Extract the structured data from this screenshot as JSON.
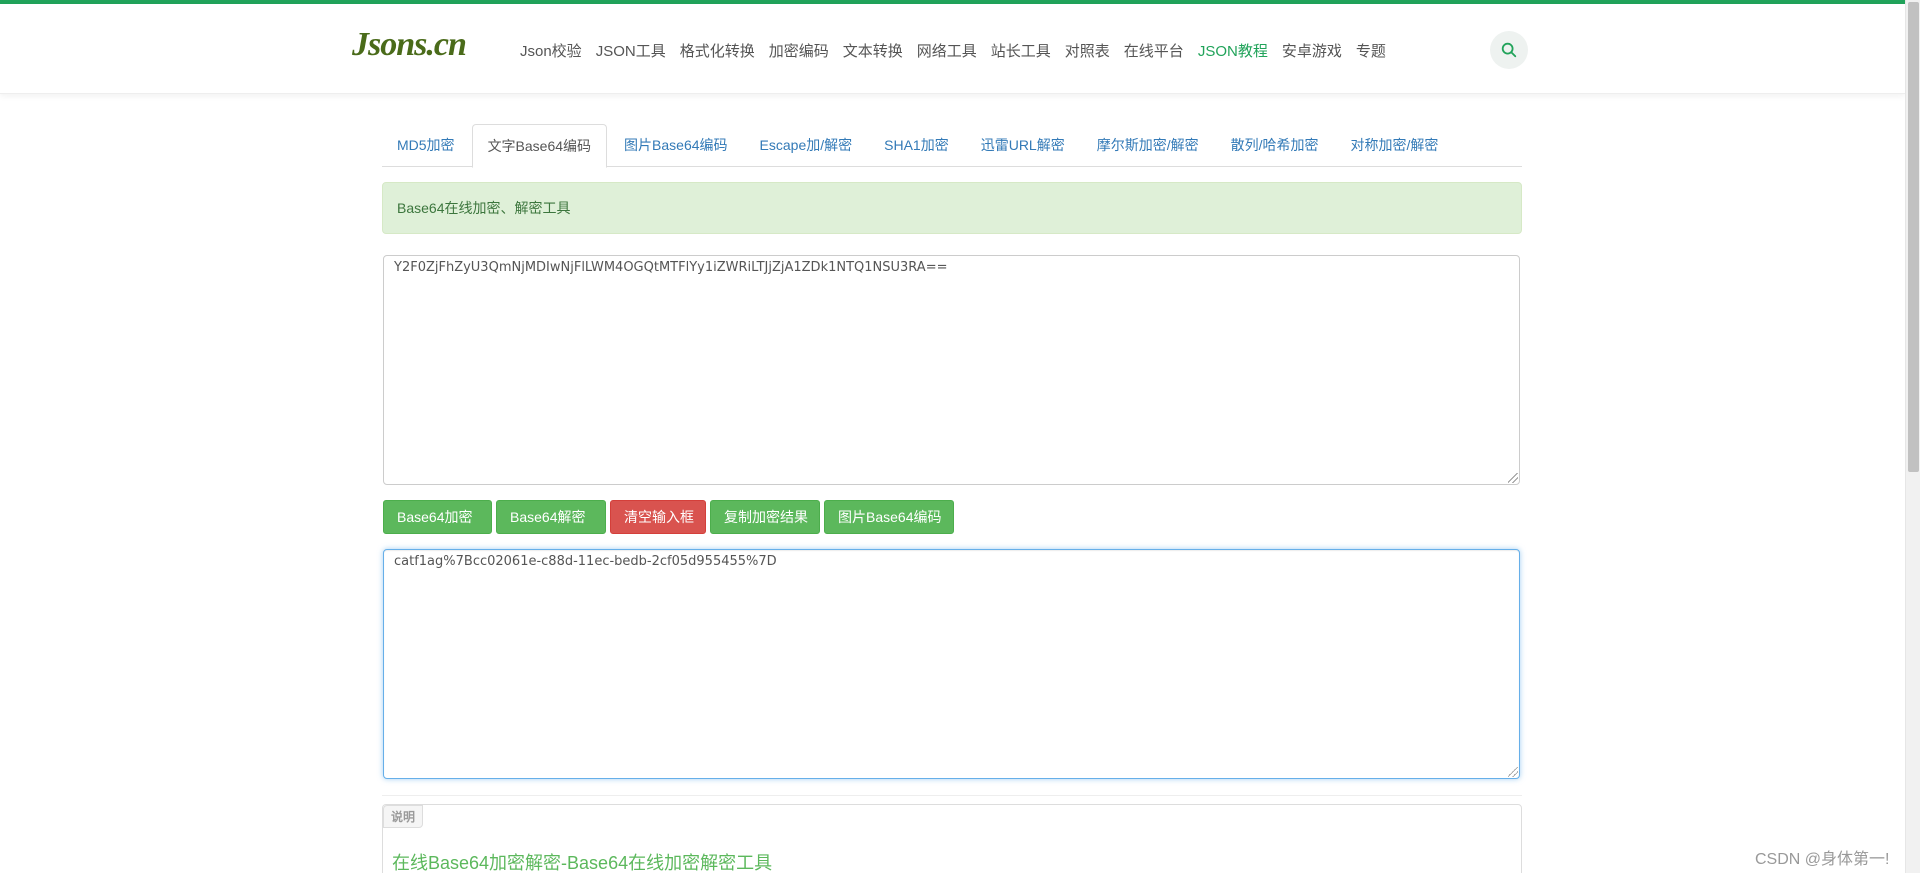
{
  "header": {
    "logo": "Jsons.cn",
    "nav": [
      {
        "label": "Json校验"
      },
      {
        "label": "JSON工具"
      },
      {
        "label": "格式化转换"
      },
      {
        "label": "加密编码"
      },
      {
        "label": "文本转换"
      },
      {
        "label": "网络工具"
      },
      {
        "label": "站长工具"
      },
      {
        "label": "对照表"
      },
      {
        "label": "在线平台"
      },
      {
        "label": "JSON教程"
      },
      {
        "label": "安卓游戏"
      },
      {
        "label": "专题"
      }
    ],
    "active_nav": "JSON教程",
    "search_icon": "search-icon"
  },
  "tabs": [
    {
      "label": "MD5加密"
    },
    {
      "label": "文字Base64编码"
    },
    {
      "label": "图片Base64编码"
    },
    {
      "label": "Escape加/解密"
    },
    {
      "label": "SHA1加密"
    },
    {
      "label": "迅雷URL解密"
    },
    {
      "label": "摩尔斯加密/解密"
    },
    {
      "label": "散列/哈希加密"
    },
    {
      "label": "对称加密/解密"
    }
  ],
  "active_tab": "文字Base64编码",
  "alert": {
    "text": "Base64在线加密、解密工具"
  },
  "input": {
    "value": "Y2F0ZjFhZyU3QmNjMDIwNjFlLWM4OGQtMTFlYy1iZWRiLTJjZjA1ZDk1NTQ1NSU3RA=="
  },
  "buttons": {
    "encrypt": "Base64加密",
    "decrypt": "Base64解密",
    "clear": "清空输入框",
    "copy": "复制加密结果",
    "image": "图片Base64编码"
  },
  "output": {
    "value": "catf1ag%7Bcc02061e-c88d-11ec-bedb-2cf05d955455%7D"
  },
  "panel": {
    "label": "说明",
    "title": "在线Base64加密解密-Base64在线加密解密工具"
  },
  "watermark": "CSDN @身体第一!",
  "colors": {
    "accent": "#21a35a",
    "button_green": "#5cb85c",
    "button_red": "#d9534f",
    "alert_bg": "#dff0d8",
    "link": "#337ab7"
  }
}
